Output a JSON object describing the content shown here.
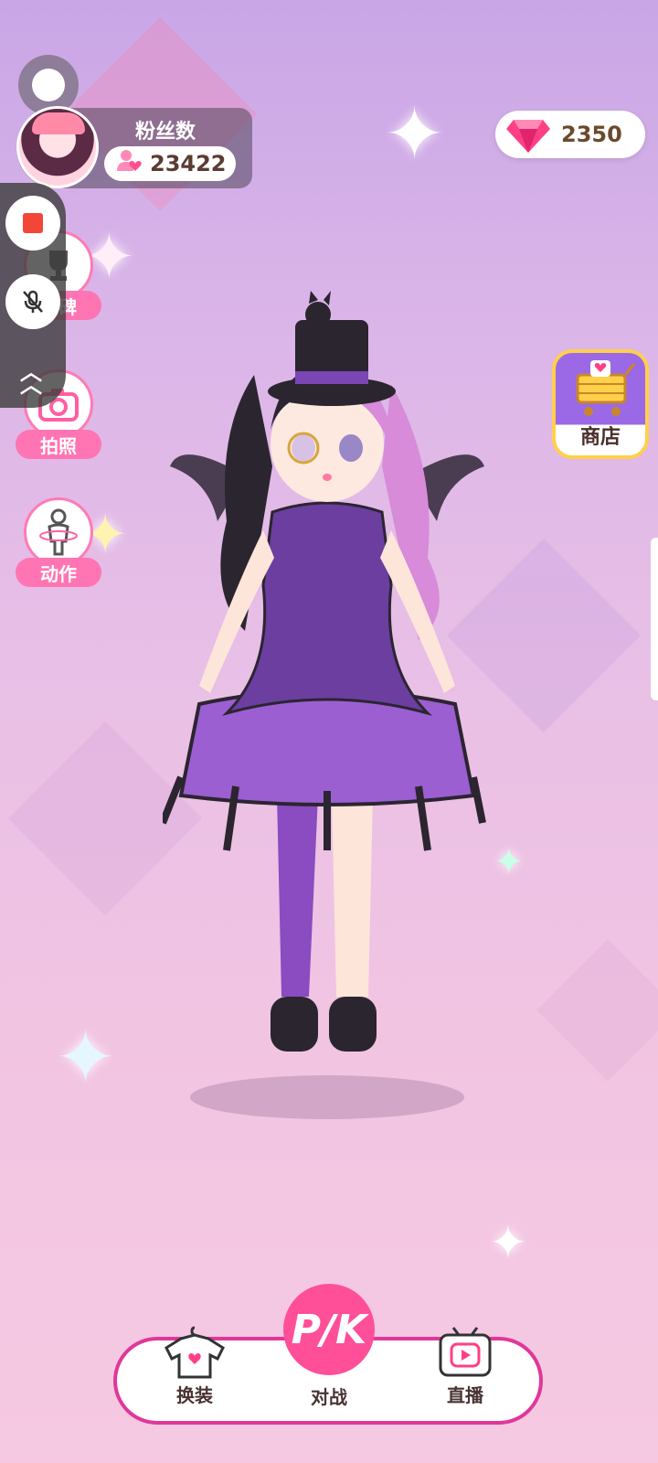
{
  "profile": {
    "fans_label": "粉丝数",
    "fans_count": "23422"
  },
  "currency": {
    "gems": "2350"
  },
  "side_menu": {
    "trophy_label": "奖碑",
    "photo_label": "拍照",
    "pose_label": "动作"
  },
  "shop": {
    "label": "商店"
  },
  "bottom_nav": {
    "dress_label": "换装",
    "battle_label": "对战",
    "battle_icon_text": "P/K",
    "live_label": "直播"
  },
  "icons": [
    "recorder-float-icon",
    "avatar-image",
    "fans-heart-icon",
    "gem-icon",
    "stop-record-icon",
    "mic-off-icon",
    "chevron-up-icon",
    "trophy-icon",
    "camera-icon",
    "pose-figure-icon",
    "shopping-cart-icon",
    "shirt-icon",
    "pk-icon",
    "tv-play-icon"
  ],
  "colors": {
    "accent_pink": "#ff74b2",
    "nav_border": "#e0379a",
    "pk_button": "#ff4f99",
    "shop_border": "#ffd04a",
    "record_red": "#f24638"
  }
}
